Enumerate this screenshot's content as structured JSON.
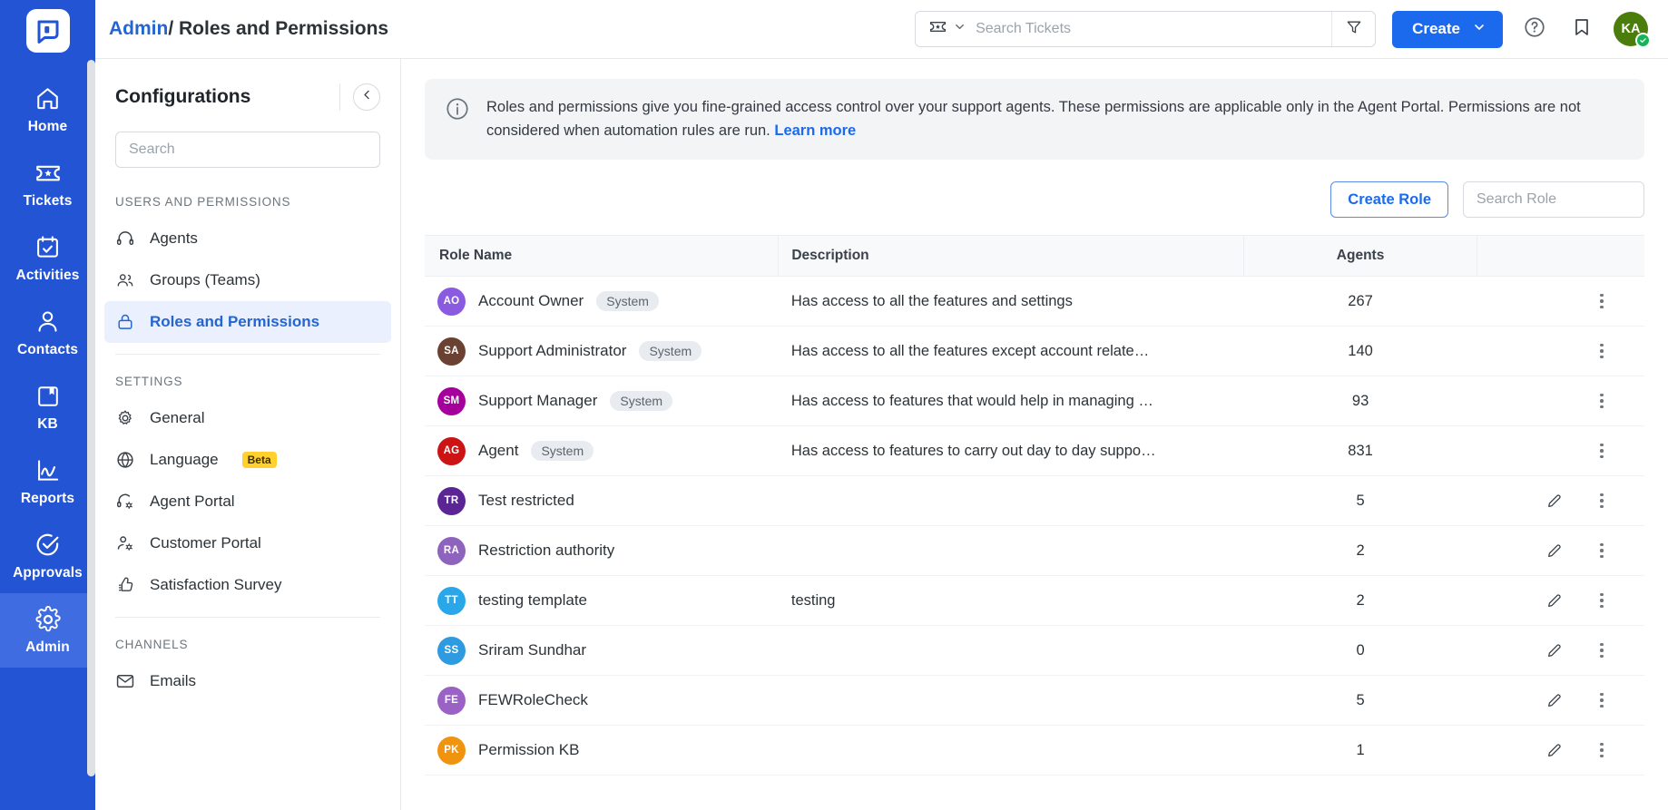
{
  "rail": {
    "logo_icon": "product-logo-icon",
    "items": [
      {
        "label": "Home",
        "icon": "home-icon",
        "active": false
      },
      {
        "label": "Tickets",
        "icon": "ticket-icon",
        "active": false
      },
      {
        "label": "Activities",
        "icon": "calendar-check-icon",
        "active": false
      },
      {
        "label": "Contacts",
        "icon": "person-icon",
        "active": false
      },
      {
        "label": "KB",
        "icon": "book-icon",
        "active": false
      },
      {
        "label": "Reports",
        "icon": "chart-line-icon",
        "active": false
      },
      {
        "label": "Approvals",
        "icon": "check-circle-icon",
        "active": false
      },
      {
        "label": "Admin",
        "icon": "gear-icon",
        "active": true
      }
    ]
  },
  "topbar": {
    "breadcrumb_link": "Admin",
    "breadcrumb_sep": "/",
    "breadcrumb_current": "Roles and Permissions",
    "search_placeholder": "Search Tickets",
    "search_value": "",
    "search_type_icon": "ticket-icon",
    "filter_icon": "funnel-icon",
    "create_label": "Create",
    "help_icon": "help-circle-icon",
    "bookmark_icon": "bookmark-icon",
    "avatar_initials": "KA",
    "avatar_color": "#4b7d0c",
    "status_color": "#16b458"
  },
  "config": {
    "title": "Configurations",
    "collapse_icon": "chevron-left-icon",
    "search_placeholder": "Search",
    "search_value": "",
    "groups": [
      {
        "title": "USERS AND PERMISSIONS",
        "items": [
          {
            "label": "Agents",
            "icon": "headset-icon",
            "active": false,
            "badge": ""
          },
          {
            "label": "Groups (Teams)",
            "icon": "people-icon",
            "active": false,
            "badge": ""
          },
          {
            "label": "Roles and Permissions",
            "icon": "lock-icon",
            "active": true,
            "badge": ""
          }
        ]
      },
      {
        "title": "SETTINGS",
        "items": [
          {
            "label": "General",
            "icon": "gear-icon",
            "active": false,
            "badge": ""
          },
          {
            "label": "Language",
            "icon": "globe-icon",
            "active": false,
            "badge": "Beta"
          },
          {
            "label": "Agent Portal",
            "icon": "headset-gear-icon",
            "active": false,
            "badge": ""
          },
          {
            "label": "Customer Portal",
            "icon": "person-gear-icon",
            "active": false,
            "badge": ""
          },
          {
            "label": "Satisfaction Survey",
            "icon": "thumbs-up-icon",
            "active": false,
            "badge": ""
          }
        ]
      },
      {
        "title": "CHANNELS",
        "items": [
          {
            "label": "Emails",
            "icon": "envelope-icon",
            "active": false,
            "badge": ""
          }
        ]
      }
    ]
  },
  "main": {
    "notice": {
      "icon": "info-circle-icon",
      "text": "Roles and permissions give you fine-grained access control over your support agents. These permissions are applicable only in the Agent Portal. Permissions are not considered when automation rules are run.",
      "link_label": "Learn more"
    },
    "create_role_label": "Create Role",
    "search_role_placeholder": "Search Role",
    "search_role_value": "",
    "table": {
      "columns": [
        "Role Name",
        "Description",
        "Agents",
        ""
      ],
      "rows": [
        {
          "initials": "AO",
          "color": "#8a5ae0",
          "name": "Account Owner",
          "tag": "System",
          "description": "Has access to all the features and settings",
          "agents": "267",
          "editable": false
        },
        {
          "initials": "SA",
          "color": "#6b4231",
          "name": "Support Administrator",
          "tag": "System",
          "description": "Has access to all the features except account relate…",
          "agents": "140",
          "editable": false
        },
        {
          "initials": "SM",
          "color": "#a5009c",
          "name": "Support Manager",
          "tag": "System",
          "description": "Has access to features that would help in managing …",
          "agents": "93",
          "editable": false
        },
        {
          "initials": "AG",
          "color": "#cc1414",
          "name": "Agent",
          "tag": "System",
          "description": "Has access to features to carry out day to day suppo…",
          "agents": "831",
          "editable": false
        },
        {
          "initials": "TR",
          "color": "#5b2596",
          "name": "Test restricted",
          "tag": "",
          "description": "",
          "agents": "5",
          "editable": true
        },
        {
          "initials": "RA",
          "color": "#8e63bd",
          "name": "Restriction authority",
          "tag": "",
          "description": "",
          "agents": "2",
          "editable": true
        },
        {
          "initials": "TT",
          "color": "#29a7e8",
          "name": "testing template",
          "tag": "",
          "description": "testing",
          "agents": "2",
          "editable": true
        },
        {
          "initials": "SS",
          "color": "#2e9be0",
          "name": "Sriram Sundhar",
          "tag": "",
          "description": "",
          "agents": "0",
          "editable": true
        },
        {
          "initials": "FE",
          "color": "#9a62c4",
          "name": "FEWRoleCheck",
          "tag": "",
          "description": "",
          "agents": "5",
          "editable": true
        },
        {
          "initials": "PK",
          "color": "#f0930f",
          "name": "Permission KB",
          "tag": "",
          "description": "",
          "agents": "1",
          "editable": true
        }
      ],
      "edit_icon": "pencil-icon",
      "more_icon": "kebab-menu-icon"
    }
  }
}
